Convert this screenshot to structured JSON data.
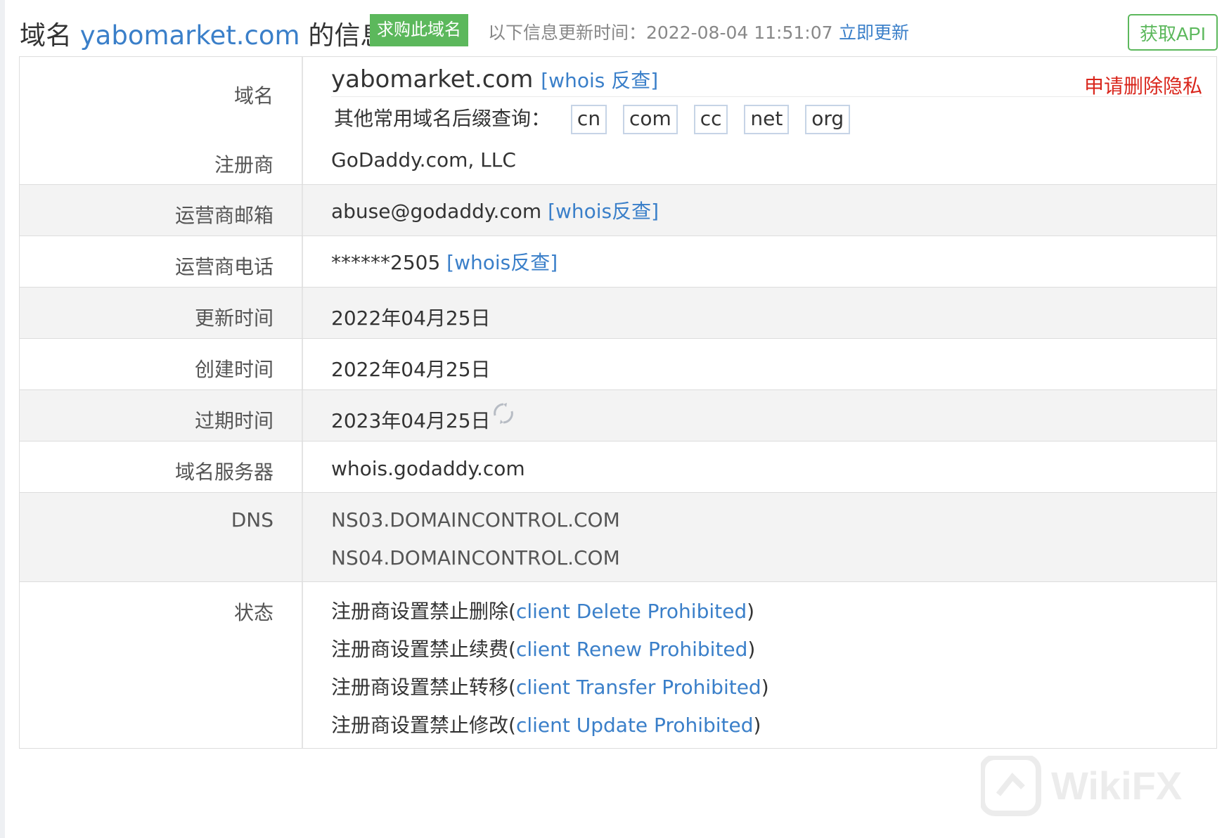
{
  "header": {
    "title_prefix": "域名 ",
    "domain": "yabomarket.com",
    "title_suffix": " 的信息",
    "buy_label": "求购此域名",
    "update_text": "以下信息更新时间：2022-08-04 11:51:07",
    "update_link": "立即更新",
    "api_label": "获取API"
  },
  "privacy_link": "申请删除隐私",
  "domain_row": {
    "label": "域名",
    "value": "yabomarket.com",
    "whois_link": "[whois 反查]",
    "suffix_prompt": "其他常用域名后缀查询：",
    "suffixes": [
      "cn",
      "com",
      "cc",
      "net",
      "org"
    ]
  },
  "registrar": {
    "label": "注册商",
    "value": "GoDaddy.com, LLC"
  },
  "email": {
    "label": "运营商邮箱",
    "value": "abuse@godaddy.com",
    "whois_link": "[whois反查]"
  },
  "phone": {
    "label": "运营商电话",
    "value": "******2505",
    "whois_link": "[whois反查]"
  },
  "updated": {
    "label": "更新时间",
    "value": "2022年04月25日"
  },
  "created": {
    "label": "创建时间",
    "value": "2022年04月25日"
  },
  "expires": {
    "label": "过期时间",
    "value": "2023年04月25日"
  },
  "whois_server": {
    "label": "域名服务器",
    "value": "whois.godaddy.com"
  },
  "dns": {
    "label": "DNS",
    "values": [
      "NS03.DOMAINCONTROL.COM",
      "NS04.DOMAINCONTROL.COM"
    ]
  },
  "status": {
    "label": "状态",
    "items": [
      {
        "cn": "注册商设置禁止删除(",
        "en": "client Delete Prohibited",
        "end": ")"
      },
      {
        "cn": "注册商设置禁止续费(",
        "en": "client Renew Prohibited",
        "end": ")"
      },
      {
        "cn": "注册商设置禁止转移(",
        "en": "client Transfer Prohibited",
        "end": ")"
      },
      {
        "cn": "注册商设置禁止修改(",
        "en": "client Update Prohibited",
        "end": ")"
      }
    ]
  },
  "watermark": "WikiFX",
  "colors": {
    "link": "#3a7fc9",
    "green": "#5cb85c",
    "red": "#d9261c",
    "alt_row": "#f3f3f3"
  }
}
